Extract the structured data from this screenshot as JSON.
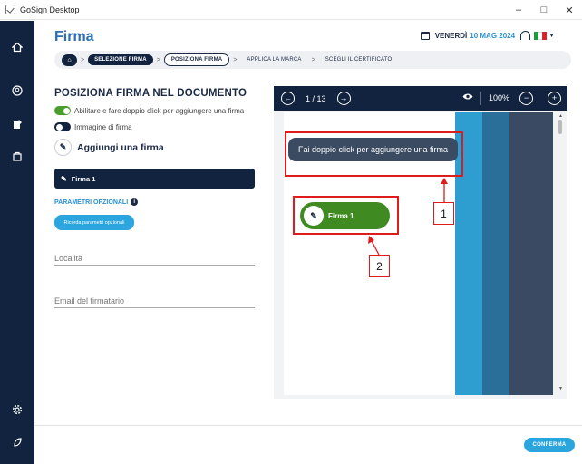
{
  "window": {
    "title": "GoSign Desktop",
    "controls": {
      "minimize": "–",
      "maximize": "□",
      "close": "✕"
    }
  },
  "sidebar": {
    "icons": [
      "home-icon",
      "user-circle-icon",
      "sign-document-icon",
      "bag-icon",
      "settings-icon",
      "leaf-icon"
    ]
  },
  "header": {
    "title": "Firma",
    "day": "VENERDÌ",
    "date": "10 MAG 2024"
  },
  "breadcrumb": {
    "steps": [
      "SELEZIONE FIRMA",
      "POSIZIONA FIRMA",
      "APPLICA LA MARCA",
      "SCEGLI IL CERTIFICATO"
    ]
  },
  "panel": {
    "title": "POSIZIONA FIRMA NEL DOCUMENTO",
    "toggle1_label": "Abilitare e fare doppio click per aggiungere una firma",
    "toggle2_label": "Immagine di firma",
    "add_signature": "Aggiungi una firma",
    "signature_item": "Firma 1",
    "optional_params": "PARAMETRI OPZIONALI",
    "remember_button": "Ricorda parametri opzionali",
    "location_placeholder": "Località",
    "email_placeholder": "Email del firmatario"
  },
  "viewer": {
    "pages": "1 / 13",
    "zoom": "100%",
    "tooltip": "Fai doppio click per aggiungere una firma",
    "signature_pill": "Firma 1"
  },
  "annotations": {
    "label1": "1",
    "label2": "2"
  },
  "footer": {
    "confirm": "CONFERMA"
  },
  "colors": {
    "navy": "#12233f",
    "accent_blue": "#2aa5de",
    "green": "#3f8a21",
    "red_annotation": "#e01b1b"
  }
}
